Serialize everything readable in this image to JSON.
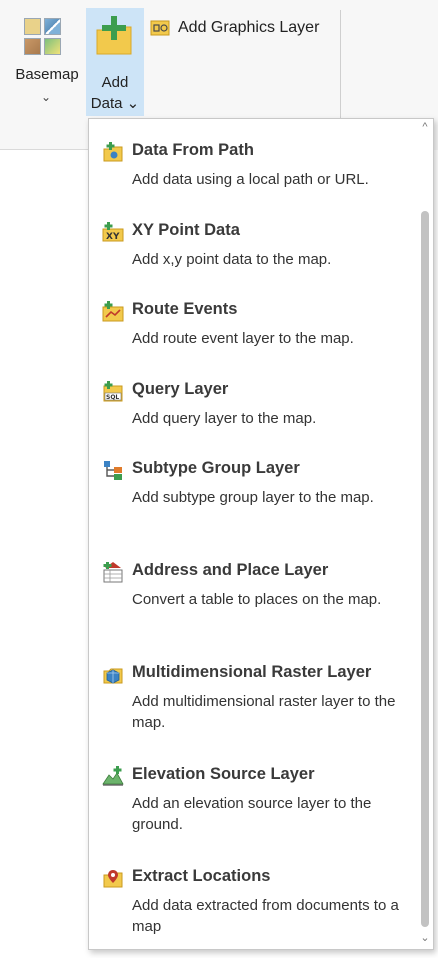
{
  "ribbon": {
    "basemap": {
      "label": "Basemap",
      "chevron": "⌄",
      "icon": "basemap-grid-icon"
    },
    "add_data": {
      "label_line1": "Add",
      "label_line2": "Data ⌄",
      "icon": "add-data-plus-icon",
      "active_bg": "#cde4f7"
    },
    "add_graphics_layer": {
      "label": "Add Graphics Layer",
      "icon": "graphics-layer-icon"
    }
  },
  "dropdown": {
    "items": [
      {
        "title": "Data From Path",
        "description": "Add data using a local path or URL.",
        "icon": "data-from-path-icon"
      },
      {
        "title": "XY Point Data",
        "description": "Add x,y point data to the map.",
        "icon": "xy-point-data-icon"
      },
      {
        "title": "Route Events",
        "description": "Add route event layer to the map.",
        "icon": "route-events-icon"
      },
      {
        "title": "Query Layer",
        "description": "Add query layer to the map.",
        "icon": "query-layer-icon"
      },
      {
        "title": "Subtype Group Layer",
        "description": "Add subtype group layer to the map.",
        "icon": "subtype-group-layer-icon"
      },
      {
        "title": "Address and Place Layer",
        "description": "Convert a table to places on the map.",
        "icon": "address-place-layer-icon"
      },
      {
        "title": "Multidimensional Raster Layer",
        "description": "Add multidimensional raster layer to the map.",
        "icon": "multidimensional-raster-icon"
      },
      {
        "title": "Elevation Source Layer",
        "description": "Add an elevation source layer to the ground.",
        "icon": "elevation-source-icon"
      },
      {
        "title": "Extract Locations",
        "description": "Add data extracted from documents to a map",
        "icon": "extract-locations-icon"
      }
    ],
    "scroll_up": "^",
    "scroll_down": "⌄"
  },
  "colors": {
    "accent_blue": "#cde4f7",
    "icon_yellow": "#f2c94c",
    "icon_green": "#3c9d4e"
  }
}
